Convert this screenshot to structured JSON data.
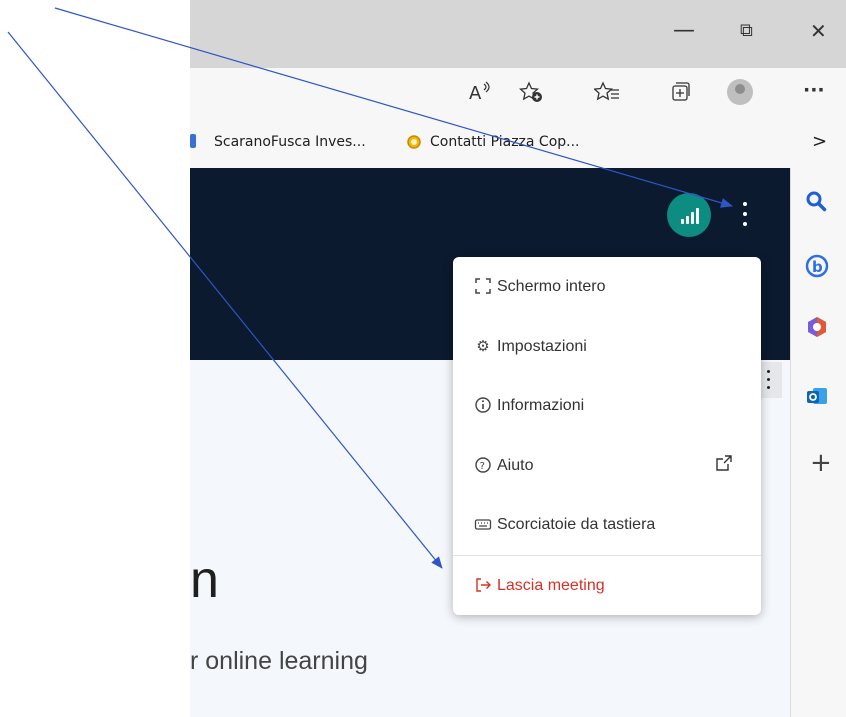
{
  "window": {
    "minimize": "—",
    "restore": "⧉",
    "close": "✕"
  },
  "toolbar": {
    "read_aloud": "A͏ʼ",
    "add_favorite": "☆",
    "favorites": "✩≡",
    "collections": "⊞",
    "more": "···"
  },
  "bookmarks": [
    {
      "label": "ScaranoFusca Inves..."
    },
    {
      "label": "Contatti Piazza Cop..."
    }
  ],
  "bookmarks_more": ">",
  "page": {
    "heading_fragment": "n",
    "subtitle_fragment": "r online learning"
  },
  "menu": {
    "items": [
      {
        "label": "Schermo intero",
        "icon": "fullscreen-icon",
        "glyph": "⛶"
      },
      {
        "label": "Impostazioni",
        "icon": "gear-icon",
        "glyph": "⚙"
      },
      {
        "label": "Informazioni",
        "icon": "info-icon",
        "glyph": "ⓘ"
      },
      {
        "label": "Aiuto",
        "icon": "help-icon",
        "glyph": "?"
      },
      {
        "label": "Scorciatoie da tastiera",
        "icon": "keyboard-icon",
        "glyph": "⌨"
      }
    ],
    "leave": {
      "label": "Lascia meeting",
      "icon": "exit-icon",
      "glyph": "[→"
    },
    "external_glyph": "⧉"
  },
  "sidebar": {
    "add": "+"
  },
  "colors": {
    "header_bg": "#0b1a2e",
    "signal_bg": "#0d8c82",
    "leave_red": "#d93025",
    "arrow_blue": "#2f55c6"
  }
}
